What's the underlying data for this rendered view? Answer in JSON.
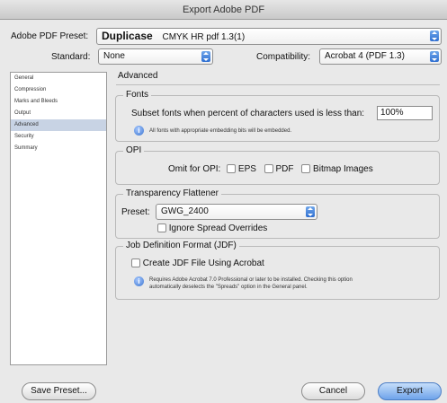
{
  "window": {
    "title": "Export Adobe PDF"
  },
  "preset": {
    "label": "Adobe PDF Preset:",
    "value_bold": "Duplicase",
    "value_rest": "CMYK HR pdf 1.3(1)"
  },
  "standard": {
    "label": "Standard:",
    "value": "None"
  },
  "compatibility": {
    "label": "Compatibility:",
    "value": "Acrobat 4 (PDF 1.3)"
  },
  "sidebar": {
    "items": [
      {
        "label": "General"
      },
      {
        "label": "Compression"
      },
      {
        "label": "Marks and Bleeds"
      },
      {
        "label": "Output"
      },
      {
        "label": "Advanced",
        "selected": true
      },
      {
        "label": "Security"
      },
      {
        "label": "Summary"
      }
    ]
  },
  "pane": {
    "title": "Advanced",
    "fonts": {
      "group_title": "Fonts",
      "subset_label": "Subset fonts when percent of characters used is less than:",
      "subset_value": "100%",
      "note": "All fonts with appropriate embedding bits will be embedded."
    },
    "opi": {
      "group_title": "OPI",
      "omit_label": "Omit for OPI:",
      "eps": "EPS",
      "pdf": "PDF",
      "bitmap": "Bitmap Images"
    },
    "transparency": {
      "group_title": "Transparency Flattener",
      "preset_label": "Preset:",
      "preset_value": "GWG_2400",
      "ignore_label": "Ignore Spread Overrides"
    },
    "jdf": {
      "group_title": "Job Definition Format (JDF)",
      "create_label": "Create JDF File Using Acrobat",
      "note_line1": "Requires Adobe Acrobat 7.0 Professional or later to be installed. Checking this option",
      "note_line2": "automatically deselects the \"Spreads\" option in the General panel."
    }
  },
  "buttons": {
    "save_preset": "Save Preset...",
    "cancel": "Cancel",
    "export": "Export"
  }
}
